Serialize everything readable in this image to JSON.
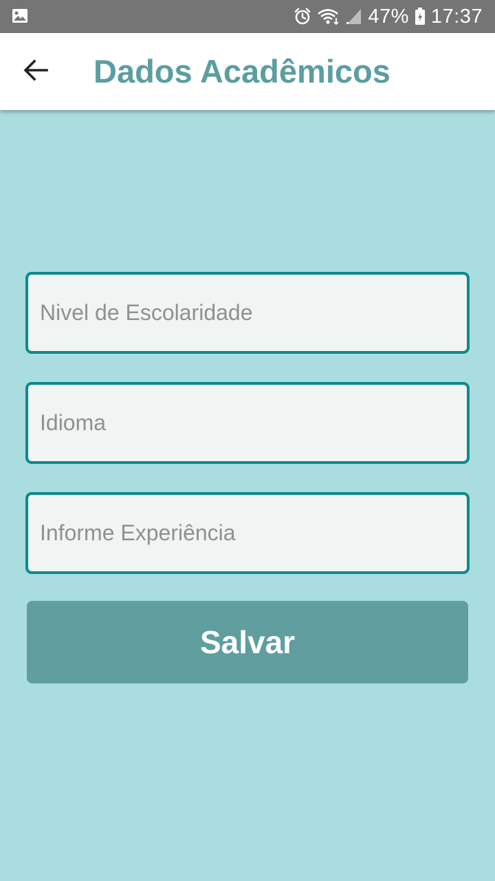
{
  "status_bar": {
    "battery": "47%",
    "time": "17:37",
    "icons": [
      "image-icon",
      "alarm-icon",
      "wifi-icon",
      "signal-icon",
      "battery-icon"
    ]
  },
  "app_bar": {
    "title": "Dados Acadêmicos",
    "back_icon": "arrow-left-icon"
  },
  "form": {
    "fields": [
      {
        "name": "education-level",
        "value": "",
        "placeholder": "Nivel de Escolaridade"
      },
      {
        "name": "language",
        "value": "",
        "placeholder": "Idioma"
      },
      {
        "name": "experience",
        "value": "",
        "placeholder": "Informe Experiência"
      }
    ],
    "save_label": "Salvar"
  },
  "colors": {
    "background": "#aadddf",
    "title": "#5b9ea0",
    "field_border": "#0e8a8a",
    "field_fill": "#f0f4f3",
    "button": "#609ea0",
    "status_bar": "#757575"
  }
}
